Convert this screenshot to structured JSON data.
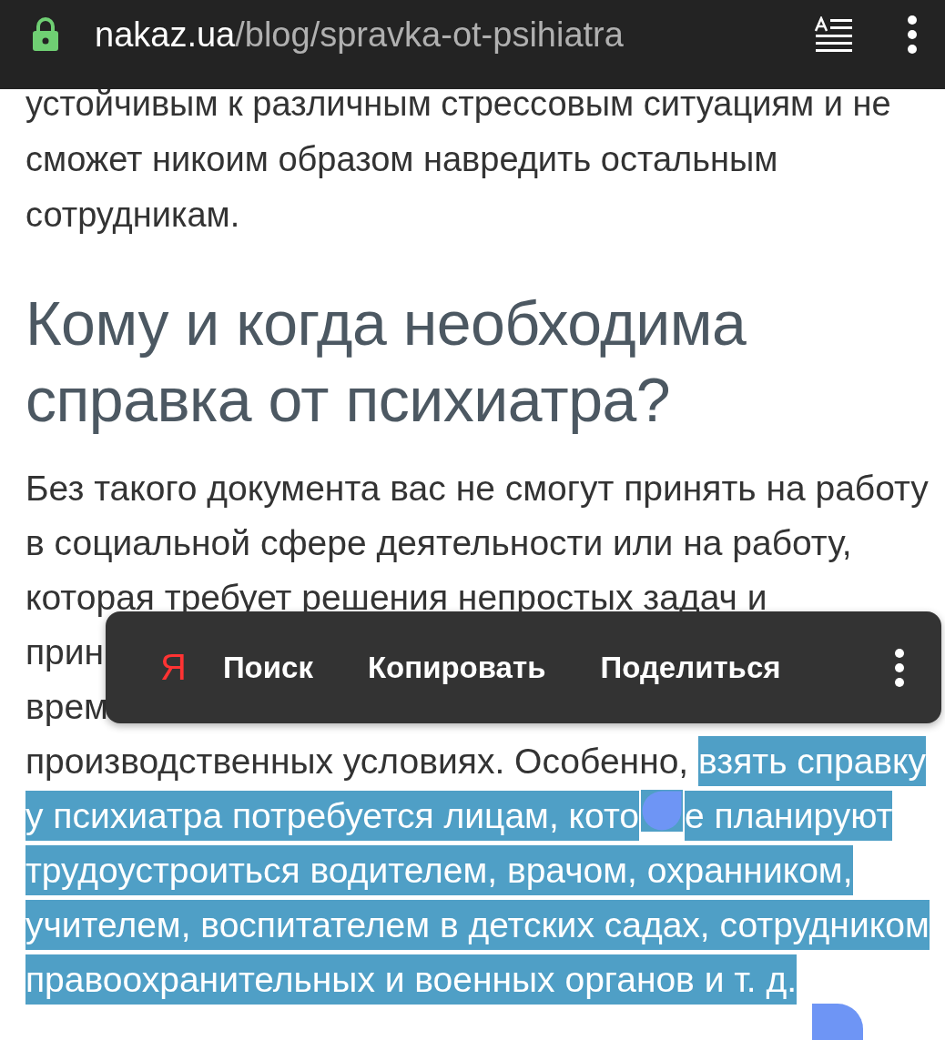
{
  "address_bar": {
    "domain": "nakaz.ua",
    "path": "/blog/spravka-ot-psihiatra"
  },
  "intro_lines": [
    "устойчивым к различным стрессовым ситуациям и не",
    "сможет никоим образом навредить остальным",
    "сотрудникам."
  ],
  "heading_lines": [
    "Кому и когда необходима",
    "справка от психиатра?"
  ],
  "paragraph_lines": [
    [
      {
        "text": "Без такого документа вас не смогут принять на работу",
        "selected": false
      }
    ],
    [
      {
        "text": "в социальной сфере деятельности или на работу,",
        "selected": false
      }
    ],
    [
      {
        "text": "которая требует решения непростых задач и",
        "selected": false
      }
    ],
    [
      {
        "text": "прин",
        "selected": false
      }
    ],
    [
      {
        "text": "врем",
        "selected": false
      }
    ],
    [
      {
        "text": "производственных условиях. Особенно, ",
        "selected": false
      },
      {
        "text": "взять справку",
        "selected": true
      }
    ],
    [
      {
        "kind": "text",
        "text": "у психиатра потребуется лицам, кото",
        "selected": true
      },
      {
        "kind": "handle"
      },
      {
        "kind": "text",
        "text": "е планируют",
        "selected": true
      }
    ],
    [
      {
        "text": "трудоустроиться водителем, врачом, охранником,",
        "selected": true
      }
    ],
    [
      {
        "text": "учителем, воспитателем в детских садах, сотрудником",
        "selected": true
      }
    ],
    [
      {
        "text": "правоохранительных и военных органов и т. д.",
        "selected": true
      }
    ]
  ],
  "selection_menu": {
    "logo": "Я",
    "actions": [
      "Поиск",
      "Копировать",
      "Поделиться"
    ]
  }
}
